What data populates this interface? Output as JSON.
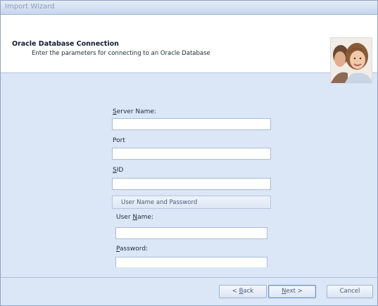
{
  "window": {
    "title": "Import Wizard"
  },
  "header": {
    "title": "Oracle Database Connection",
    "subtitle": "Enter the parameters for connecting to an Oracle Database",
    "icon": "people-photo-icon"
  },
  "form": {
    "server_name": {
      "label_acc": "S",
      "label_rest": "erver Name:",
      "value": ""
    },
    "port": {
      "label": "Port",
      "value": ""
    },
    "sid": {
      "label_acc": "S",
      "label_rest": "ID",
      "value": ""
    },
    "credentials": {
      "group_title": "User Name and Password",
      "user_name": {
        "label_pre": "User ",
        "label_acc": "N",
        "label_rest": "ame:",
        "value": ""
      },
      "password": {
        "label_acc": "P",
        "label_rest": "assword:",
        "value": ""
      }
    }
  },
  "buttons": {
    "back": {
      "prefix": "< ",
      "acc": "B",
      "rest": "ack"
    },
    "next": {
      "acc": "N",
      "rest": "ext >"
    },
    "cancel": {
      "label": "Cancel"
    }
  }
}
